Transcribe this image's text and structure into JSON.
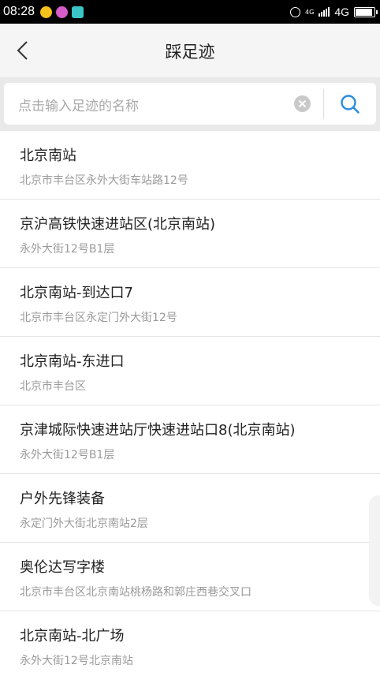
{
  "status_bar": {
    "time": "08:28",
    "network_small": "4G",
    "network_label": "4G"
  },
  "header": {
    "title": "踩足迹"
  },
  "search": {
    "placeholder": "点击输入足迹的名称"
  },
  "results": [
    {
      "name": "北京南站",
      "address": "北京市丰台区永外大街车站路12号"
    },
    {
      "name": "京沪高铁快速进站区(北京南站)",
      "address": "永外大街12号B1层"
    },
    {
      "name": "北京南站-到达口7",
      "address": "北京市丰台区永定门外大街12号"
    },
    {
      "name": "北京南站-东进口",
      "address": "北京市丰台区"
    },
    {
      "name": "京津城际快速进站厅快速进站口8(北京南站)",
      "address": "永外大街12号B1层"
    },
    {
      "name": "户外先锋装备",
      "address": "永定门外大街北京南站2层"
    },
    {
      "name": "奥伦达写字楼",
      "address": "北京市丰台区北京南站桃杨路和郭庄西巷交叉口"
    },
    {
      "name": "北京南站-北广场",
      "address": "永外大街12号北京南站"
    }
  ],
  "colors": {
    "accent": "#2b8be0",
    "header_bg": "#f5f5f5",
    "search_area_bg": "#e9e9e9"
  },
  "icons": [
    "back-chevron-icon",
    "clear-icon",
    "search-icon",
    "alarm-icon",
    "signal-icon",
    "battery-icon"
  ]
}
